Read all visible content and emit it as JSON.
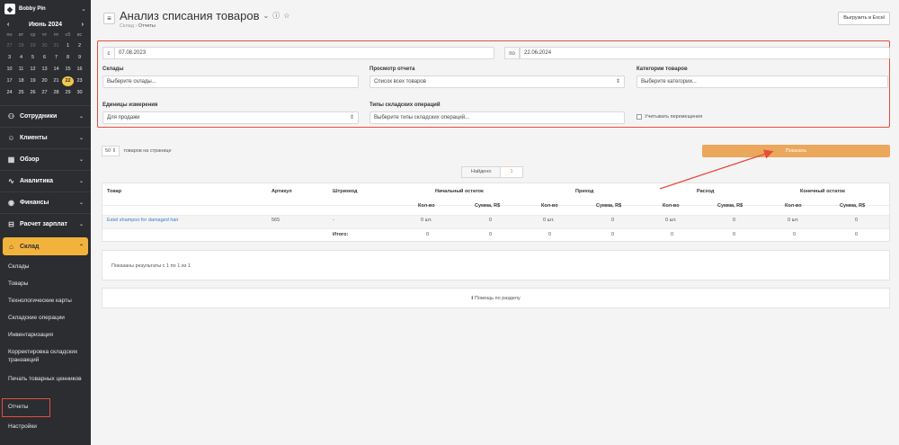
{
  "sidebar": {
    "user_name": "Bobby Pin",
    "calendar": {
      "month": "Июнь 2024",
      "prev": "‹",
      "next": "›",
      "weekdays": [
        "пн",
        "вт",
        "ср",
        "чт",
        "пт",
        "сб",
        "вс"
      ],
      "weeks": [
        [
          {
            "d": "27",
            "dim": true
          },
          {
            "d": "28",
            "dim": true
          },
          {
            "d": "29",
            "dim": true
          },
          {
            "d": "30",
            "dim": true
          },
          {
            "d": "31",
            "dim": true
          },
          {
            "d": "1"
          },
          {
            "d": "2"
          }
        ],
        [
          {
            "d": "3"
          },
          {
            "d": "4"
          },
          {
            "d": "5"
          },
          {
            "d": "6"
          },
          {
            "d": "7"
          },
          {
            "d": "8"
          },
          {
            "d": "9"
          }
        ],
        [
          {
            "d": "10"
          },
          {
            "d": "11"
          },
          {
            "d": "12"
          },
          {
            "d": "13"
          },
          {
            "d": "14"
          },
          {
            "d": "15"
          },
          {
            "d": "16"
          }
        ],
        [
          {
            "d": "17"
          },
          {
            "d": "18"
          },
          {
            "d": "19"
          },
          {
            "d": "20"
          },
          {
            "d": "21"
          },
          {
            "d": "22",
            "today": true
          },
          {
            "d": "23"
          }
        ],
        [
          {
            "d": "24"
          },
          {
            "d": "25"
          },
          {
            "d": "26"
          },
          {
            "d": "27"
          },
          {
            "d": "28"
          },
          {
            "d": "29"
          },
          {
            "d": "30"
          }
        ]
      ]
    },
    "nav": [
      {
        "label": "Сотрудники",
        "icon": "employees-icon",
        "glyph": "⚇"
      },
      {
        "label": "Клиенты",
        "icon": "clients-icon",
        "glyph": "☺"
      },
      {
        "label": "Обзор",
        "icon": "overview-icon",
        "glyph": "▦"
      },
      {
        "label": "Аналитика",
        "icon": "analytics-icon",
        "glyph": "∿"
      },
      {
        "label": "Финансы",
        "icon": "finance-icon",
        "glyph": "◉"
      },
      {
        "label": "Расчет зарплат",
        "icon": "payroll-icon",
        "glyph": "⊟"
      }
    ],
    "active": {
      "label": "Склад",
      "icon": "warehouse-icon",
      "glyph": "⌂"
    },
    "sub_items": [
      "Склады",
      "Товары",
      "Технологические карты",
      "Складские операции",
      "Инвентаризация",
      "Корректировка складских транзакций",
      "Печать товарных ценников",
      "Отчеты",
      "Настройки"
    ]
  },
  "header": {
    "title": "Анализ списания товаров",
    "breadcrumb_root": "Склад",
    "breadcrumb_current": "Отчеты",
    "export_label": "Выгрузить в Excel"
  },
  "filters": {
    "from_prefix": "с",
    "from_date": "07.08.2023",
    "to_prefix": "по",
    "to_date": "22.06.2024",
    "warehouses_label": "Склады",
    "warehouses_placeholder": "Выберите склады...",
    "view_label": "Просмотр отчета",
    "view_value": "Список всех товаров",
    "categories_label": "Категории товаров",
    "categories_placeholder": "Выберите категории...",
    "units_label": "Единицы измерения",
    "units_value": "Для продажи",
    "optypes_label": "Типы складских операций",
    "optypes_placeholder": "Выберите типы складских операций...",
    "transfers_label": "Учитывать перемещения"
  },
  "controls": {
    "per_page_value": "50",
    "per_page_text": "товаров на странице",
    "show_label": "Показать",
    "found_label": "Найдено",
    "found_count": "1"
  },
  "table": {
    "h_product": "Товар",
    "h_article": "Артикул",
    "h_barcode": "Штрихкод",
    "h_start": "Начальный остаток",
    "h_in": "Приход",
    "h_out": "Расход",
    "h_end": "Конечный остаток",
    "sub_qty": "Кол-во",
    "sub_sum": "Сумма, R$",
    "row": {
      "product": "Estel shampoo for damaged hair",
      "article": "565",
      "barcode": "-",
      "start_qty": "0 шт.",
      "start_sum": "0",
      "in_qty": "0 шт.",
      "in_sum": "0",
      "out_qty": "0 шт.",
      "out_sum": "0",
      "end_qty": "0 шт.",
      "end_sum": "0"
    },
    "total": {
      "label": "Итого:",
      "start_qty": "0",
      "start_sum": "0",
      "in_qty": "0",
      "in_sum": "0",
      "out_qty": "0",
      "out_sum": "0",
      "end_qty": "0",
      "end_sum": "0"
    }
  },
  "results_text": "Показаны результаты с 1 по 1 из 1",
  "help_text": "Помощь по разделу",
  "colors": {
    "accent": "#eba75b",
    "highlight": "#e74c3c",
    "sidebar": "#2b2d31",
    "today": "#f2c94c"
  }
}
